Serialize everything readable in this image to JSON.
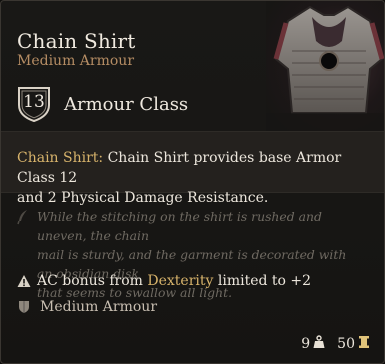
{
  "item": {
    "name": "Chain Shirt",
    "category": "Medium Armour"
  },
  "armour_class": {
    "value": "13",
    "label": "Armour Class"
  },
  "description": {
    "name_highlight": "Chain Shirt:",
    "line1_rest": "Chain Shirt provides base Armor Class 12",
    "line2": "and 2 Physical Damage Resistance."
  },
  "lore": {
    "line1": "While the stitching on the shirt is rushed and uneven, the chain",
    "line2": "mail is sturdy, and the garment is decorated with an obsidian disk",
    "line3": "that seems to swallow all light."
  },
  "properties": {
    "dex_warning_prefix": "AC bonus from",
    "dex_warning_stat": "Dexterity",
    "dex_warning_suffix": "limited to +2",
    "proficiency": "Medium Armour"
  },
  "footer": {
    "weight": "9",
    "value": "50"
  },
  "icons": {
    "ac": "shield-icon",
    "lore": "quill-icon",
    "warning": "warning-icon",
    "proficiency": "armour-icon",
    "weight": "weight-icon",
    "gold": "gold-coin-icon"
  },
  "colors": {
    "accent_gold": "#d7b36b",
    "category_brown": "#b58d64",
    "lore_grey": "#6f6a62"
  }
}
